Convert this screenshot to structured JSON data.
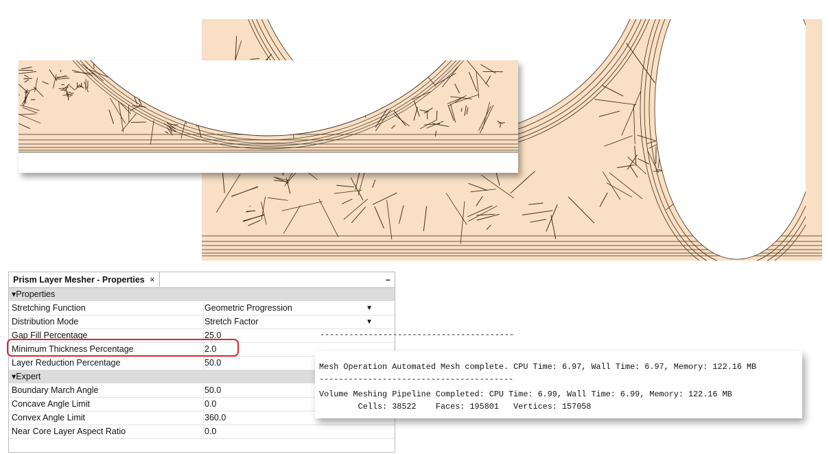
{
  "panel": {
    "title": "Prism Layer Mesher - Properties",
    "close_glyph": "×",
    "minimize_glyph": "–",
    "categories": [
      {
        "label": "Properties",
        "rows": [
          {
            "key": "Stretching Function",
            "value": "Geometric Progression",
            "dropdown": true
          },
          {
            "key": "Distribution Mode",
            "value": "Stretch Factor",
            "dropdown": true
          },
          {
            "key": "Gap Fill Percentage",
            "value": "25.0",
            "dropdown": false
          },
          {
            "key": "Minimum Thickness Percentage",
            "value": "2.0",
            "dropdown": false
          },
          {
            "key": "Layer Reduction Percentage",
            "value": "50.0",
            "dropdown": false
          }
        ]
      },
      {
        "label": "Expert",
        "rows": [
          {
            "key": "Boundary March Angle",
            "value": "50.0",
            "dropdown": false
          },
          {
            "key": "Concave Angle Limit",
            "value": "0.0",
            "dropdown": false
          },
          {
            "key": "Convex Angle Limit",
            "value": "360.0",
            "dropdown": false
          },
          {
            "key": "Near Core Layer Aspect Ratio",
            "value": "0.0",
            "dropdown": false
          }
        ]
      }
    ]
  },
  "console": {
    "separator": "----------------------------------------",
    "line1": "Mesh Operation Automated Mesh complete. CPU Time: 6.97, Wall Time: 6.97, Memory: 122.16 MB",
    "separator2": "----------------------------------------",
    "line2": "Volume Meshing Pipeline Completed: CPU Time: 6.99, Wall Time: 6.99, Memory: 122.16 MB",
    "line3": "        Cells: 38522    Faces: 195801   Vertices: 157058"
  },
  "colors": {
    "mesh_fill": "#f9dfc3",
    "mesh_line": "#3a2a1a",
    "highlight": "#d8262c",
    "category_bg": "#dcdcdc"
  }
}
